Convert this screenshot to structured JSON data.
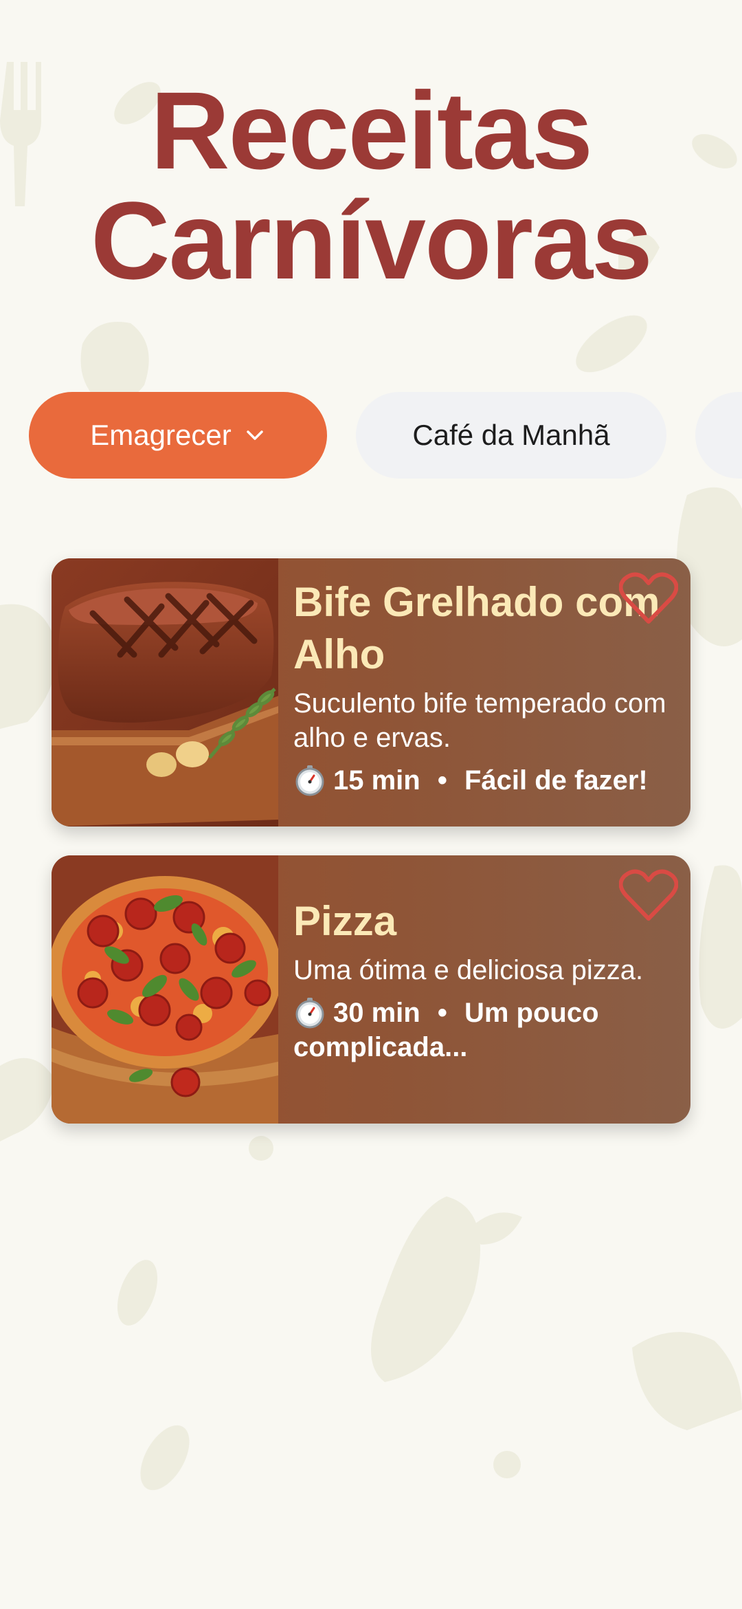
{
  "header": {
    "title_line1": "Receitas",
    "title_line2": "Carnívoras"
  },
  "filters": {
    "active": {
      "label": "Emagrecer",
      "icon": "chevron-down-icon"
    },
    "items": [
      {
        "label": "Café da Manhã"
      }
    ]
  },
  "recipes": [
    {
      "title": "Bife Grelhado com Alho",
      "description": "Suculento bife temperado com alho e ervas.",
      "time": "15 min",
      "separator": "•",
      "difficulty": "Fácil de fazer!",
      "image": "steak-image",
      "favorite_icon": "heart-outline-icon"
    },
    {
      "title": "Pizza",
      "description": "Uma ótima e deliciosa pizza.",
      "time": "30 min",
      "separator": "•",
      "difficulty": "Um pouco complicada...",
      "image": "pizza-image",
      "favorite_icon": "heart-outline-icon"
    }
  ],
  "colors": {
    "background": "#f9f8f2",
    "title": "#9b3a36",
    "accent": "#e96a3c",
    "chip_inactive": "#f1f2f4",
    "card_title": "#fbe9b7",
    "heart": "#d94b44"
  }
}
